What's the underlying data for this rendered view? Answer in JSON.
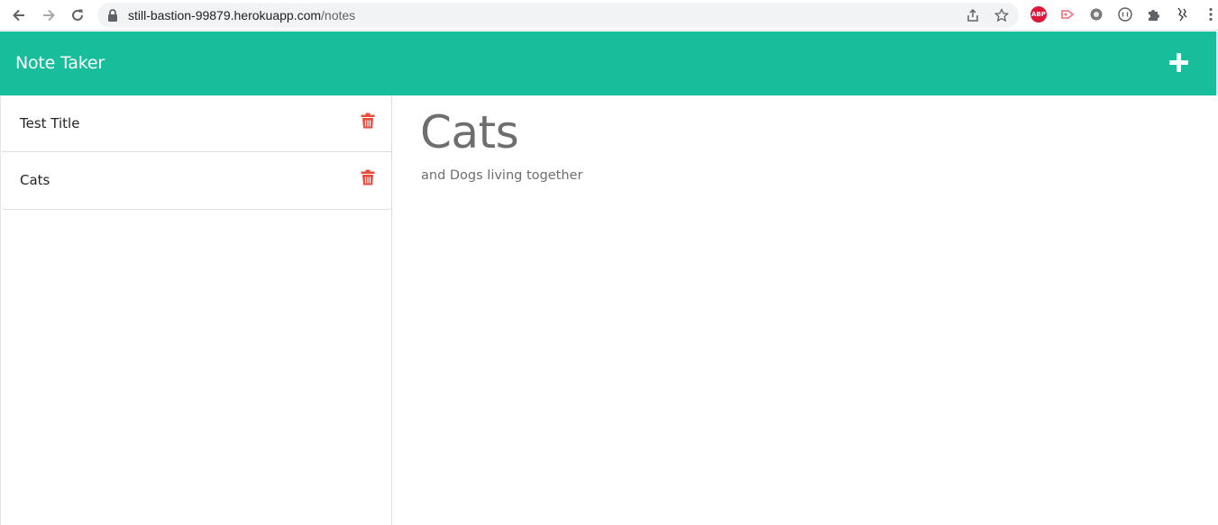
{
  "browser": {
    "url_host": "still-bastion-99879.herokuapp.com",
    "url_path": "/notes",
    "icons": [
      "back-icon",
      "forward-icon",
      "reload-icon",
      "lock-icon",
      "share-icon",
      "star-icon",
      "adblock-icon",
      "cast-icon",
      "extension-gear-icon",
      "extension-circle-icon",
      "puzzle-icon",
      "profile-icon",
      "menu-icon"
    ],
    "abp_label": "ABP"
  },
  "app": {
    "brand": "Note Taker",
    "accent_color": "#18bd9b",
    "delete_color": "#e74c3c"
  },
  "notes": [
    {
      "title": "Test Title"
    },
    {
      "title": "Cats"
    }
  ],
  "active_note": {
    "title": "Cats",
    "text": "and Dogs living together"
  }
}
